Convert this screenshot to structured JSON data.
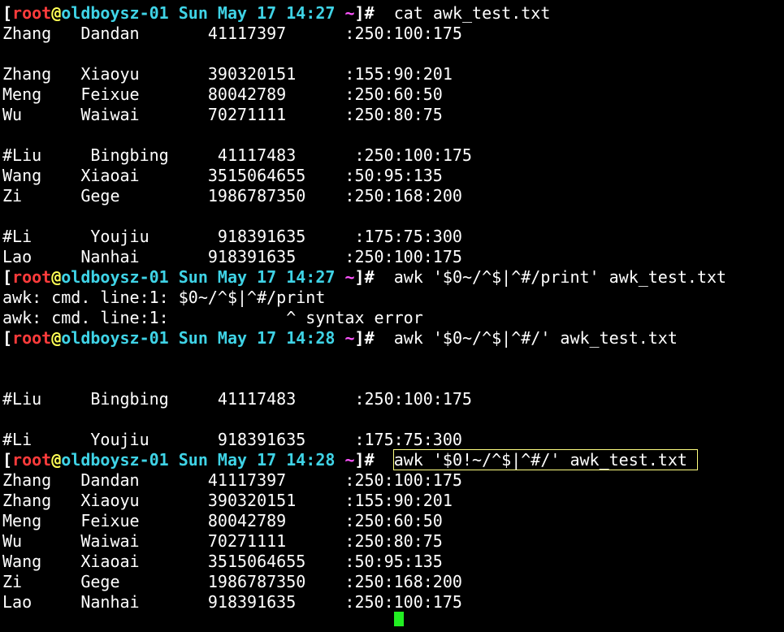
{
  "terminal": {
    "prompt": {
      "user": "root",
      "at": "@",
      "host": "oldboysz-01",
      "tilde": "~",
      "hash": "#"
    },
    "lines": [
      {
        "type": "prompt",
        "date": "Sun May 17 14:27",
        "cmd": "cat awk_test.txt"
      },
      {
        "type": "output",
        "text": "Zhang   Dandan       41117397      :250:100:175"
      },
      {
        "type": "output",
        "text": ""
      },
      {
        "type": "output",
        "text": "Zhang   Xiaoyu       390320151     :155:90:201"
      },
      {
        "type": "output",
        "text": "Meng    Feixue       80042789      :250:60:50"
      },
      {
        "type": "output",
        "text": "Wu      Waiwai       70271111      :250:80:75"
      },
      {
        "type": "output",
        "text": ""
      },
      {
        "type": "output",
        "text": "#Liu     Bingbing     41117483      :250:100:175"
      },
      {
        "type": "output",
        "text": "Wang    Xiaoai       3515064655    :50:95:135"
      },
      {
        "type": "output",
        "text": "Zi      Gege         1986787350    :250:168:200"
      },
      {
        "type": "output",
        "text": ""
      },
      {
        "type": "output",
        "text": "#Li      Youjiu       918391635     :175:75:300"
      },
      {
        "type": "output",
        "text": "Lao     Nanhai       918391635     :250:100:175"
      },
      {
        "type": "prompt",
        "date": "Sun May 17 14:27",
        "cmd": "awk '$0~/^$|^#/print' awk_test.txt"
      },
      {
        "type": "output",
        "text": "awk: cmd. line:1: $0~/^$|^#/print"
      },
      {
        "type": "output",
        "text": "awk: cmd. line:1:            ^ syntax error"
      },
      {
        "type": "prompt",
        "date": "Sun May 17 14:28",
        "cmd": "awk '$0~/^$|^#/' awk_test.txt"
      },
      {
        "type": "output",
        "text": ""
      },
      {
        "type": "output",
        "text": ""
      },
      {
        "type": "output",
        "text": "#Liu     Bingbing     41117483      :250:100:175"
      },
      {
        "type": "output",
        "text": ""
      },
      {
        "type": "output",
        "text": "#Li      Youjiu       918391635     :175:75:300"
      },
      {
        "type": "prompt",
        "date": "Sun May 17 14:28",
        "cmd": "awk '$0!~/^$|^#/' awk_test.txt ",
        "highlight": true
      },
      {
        "type": "output",
        "text": "Zhang   Dandan       41117397      :250:100:175"
      },
      {
        "type": "output",
        "text": "Zhang   Xiaoyu       390320151     :155:90:201"
      },
      {
        "type": "output",
        "text": "Meng    Feixue       80042789      :250:60:50"
      },
      {
        "type": "output",
        "text": "Wu      Waiwai       70271111      :250:80:75"
      },
      {
        "type": "output",
        "text": "Wang    Xiaoai       3515064655    :50:95:135"
      },
      {
        "type": "output",
        "text": "Zi      Gege         1986787350    :250:168:200"
      },
      {
        "type": "output",
        "text": "Lao     Nanhai       918391635     :250:100:175"
      }
    ]
  },
  "colors": {
    "background": "#000000",
    "text": "#ffffff",
    "user": "#ff3b3b",
    "at": "#ffff55",
    "host": "#3fd3e6",
    "tilde": "#ff55ff",
    "cursor": "#22ee22",
    "highlight_box": "#ffff80"
  },
  "cursor_icon": "block-cursor"
}
